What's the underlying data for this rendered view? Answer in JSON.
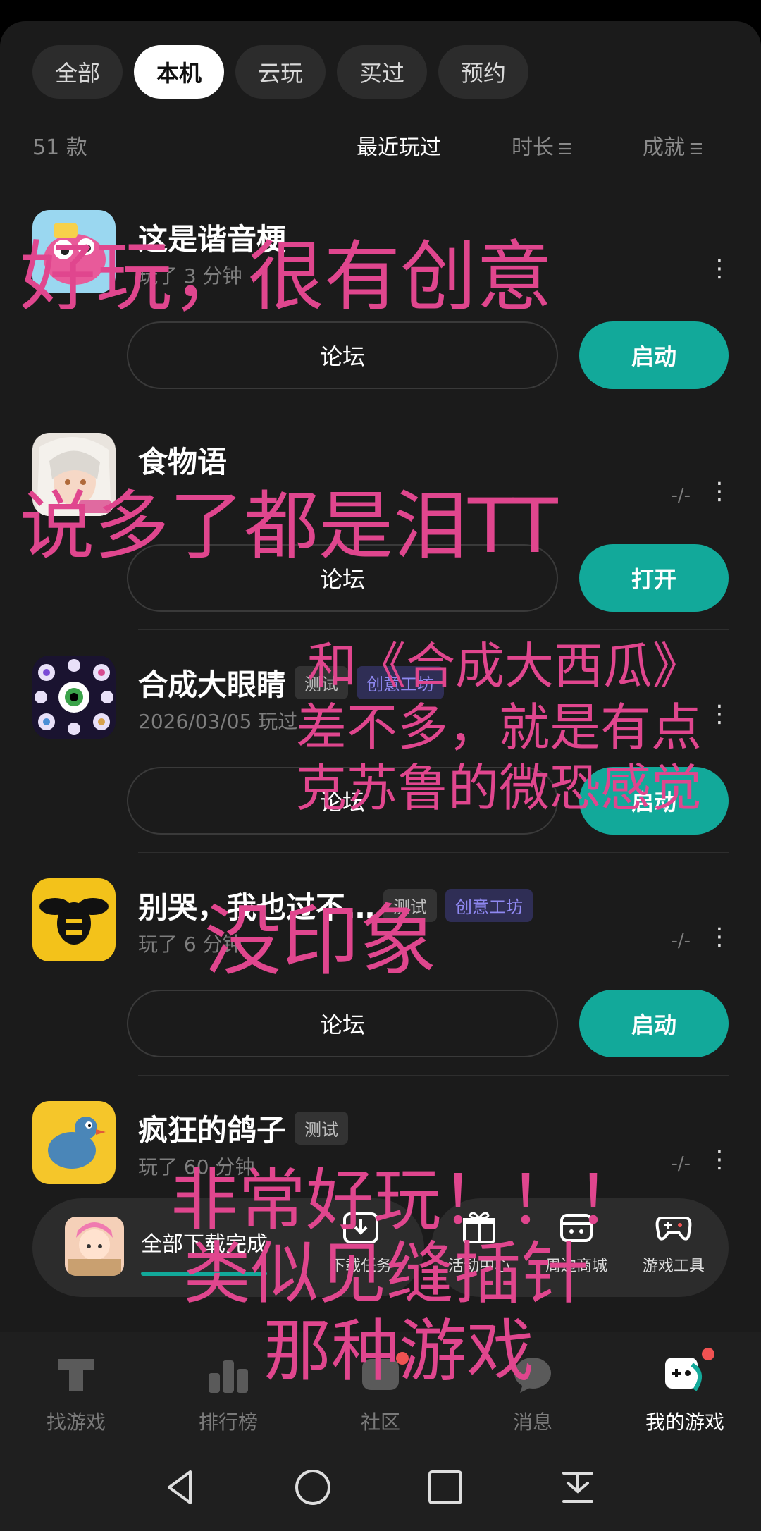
{
  "tabs": [
    {
      "label": "全部",
      "active": false
    },
    {
      "label": "本机",
      "active": true
    },
    {
      "label": "云玩",
      "active": false
    },
    {
      "label": "买过",
      "active": false
    },
    {
      "label": "预约",
      "active": false
    }
  ],
  "toolbar": {
    "count": "51 款",
    "sort_recent": "最近玩过",
    "sort_duration": "时长",
    "sort_achievement": "成就"
  },
  "games": [
    {
      "name": "这是谐音梗",
      "tags": [],
      "meta": "玩了 3 分钟",
      "score": "",
      "forum": "论坛",
      "action": "启动"
    },
    {
      "name": "食物语",
      "tags": [],
      "meta": "",
      "score": "-/-",
      "forum": "论坛",
      "action": "打开",
      "icon_badge": "经典版"
    },
    {
      "name": "合成大眼睛",
      "tags": [
        "测试",
        "创意工坊"
      ],
      "meta": "2026/03/05 玩过",
      "score": "",
      "forum": "论坛",
      "action": "启动"
    },
    {
      "name": "别哭，我也过不…",
      "tags": [
        "测试",
        "创意工坊"
      ],
      "meta": "玩了 6 分钟",
      "score": "-/-",
      "forum": "论坛",
      "action": "启动"
    },
    {
      "name": "疯狂的鸽子",
      "tags": [
        "测试"
      ],
      "meta": "玩了 60 分钟",
      "score": "-/-",
      "forum": "",
      "action": ""
    }
  ],
  "download": {
    "status": "全部下载完成",
    "progress": 0.85,
    "quick": [
      "下载任务",
      "活动中心",
      "周边商城",
      "游戏工具"
    ]
  },
  "bottom_nav": [
    "找游戏",
    "排行榜",
    "社区",
    "消息",
    "我的游戏"
  ],
  "overlays": {
    "o1": "好玩，很有创意",
    "o2": "说多了都是泪TT",
    "o3a": "和《合成大西瓜》",
    "o3b": "差不多，就是有点",
    "o3c": "克苏鲁的微恐感觉",
    "o4": "没印象",
    "o5a": "非常好玩！！！",
    "o5b": "类似见缝插针",
    "o5c": "那种游戏"
  },
  "colors": {
    "accent": "#12a99a",
    "overlay_text": "#e0468e",
    "creative_tag": "#8f88f1"
  }
}
